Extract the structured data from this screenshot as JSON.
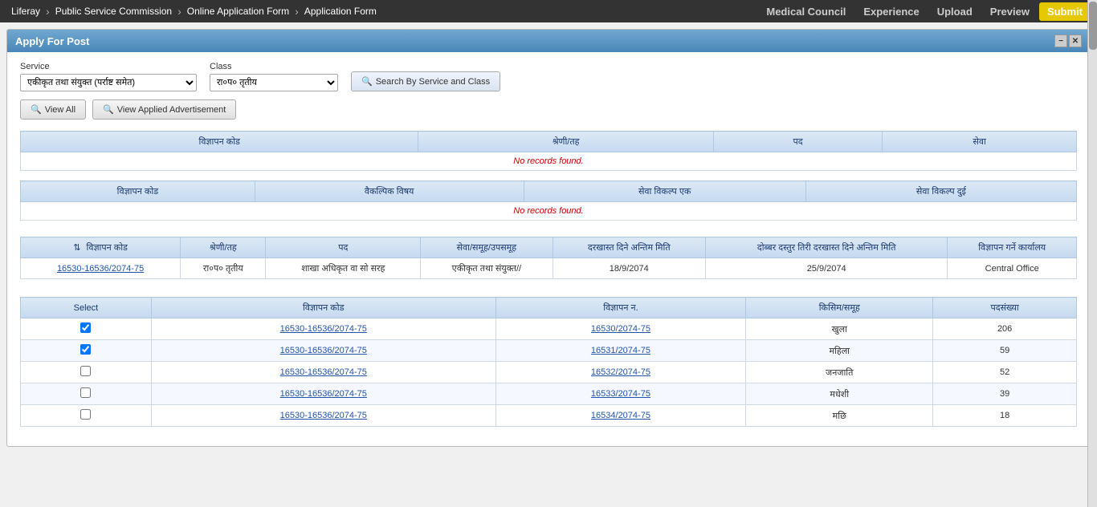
{
  "breadcrumb": {
    "items": [
      {
        "label": "Liferay",
        "active": false
      },
      {
        "label": "Public Service Commission",
        "active": false
      },
      {
        "label": "Online Application Form",
        "active": false
      },
      {
        "label": "Application Form",
        "active": false
      }
    ]
  },
  "tabs": [
    {
      "label": "Medical Council",
      "active": false
    },
    {
      "label": "Experience",
      "active": false
    },
    {
      "label": "Upload",
      "active": false
    },
    {
      "label": "Preview",
      "active": false
    },
    {
      "label": "Submit",
      "active": true
    }
  ],
  "panel": {
    "title": "Apply For Post",
    "minimize_label": "−",
    "close_label": "✕"
  },
  "form": {
    "service_label": "Service",
    "service_value": "एकीकृत तथा संयुक्त (पर्राष्ट समेत)",
    "class_label": "Class",
    "class_value": "रा०प० तृतीय",
    "search_btn_label": "Search By Service and Class",
    "view_all_label": "View All",
    "view_applied_label": "View Applied Advertisement"
  },
  "table1": {
    "headers": [
      "विज्ञापन कोड",
      "श्रेणी/तह",
      "पद",
      "सेवा"
    ],
    "no_records": "No records found."
  },
  "table2": {
    "headers": [
      "विज्ञापन कोड",
      "वैकल्पिक विषय",
      "सेवा विकल्प एक",
      "सेवा विकल्प दुई"
    ],
    "no_records": "No records found."
  },
  "table3": {
    "headers": [
      "विज्ञापन कोड",
      "श्रेणी/तह",
      "पद",
      "सेवा/समूह/उपसमूह",
      "दरखास्त दिने अन्तिम मिति",
      "दोब्बर दस्तुर तिरी दरखास्त दिने अन्तिम मिति",
      "विज्ञापन गर्ने कार्यालय"
    ],
    "rows": [
      {
        "code": "16530-16536/2074-75",
        "grade": "रा०प० तृतीय",
        "post": "शाखा अधिकृत वा सो सरह",
        "service": "एकीकृत तथा संयुक्त//",
        "deadline": "18/9/2074",
        "double_deadline": "25/9/2074",
        "office": "Central Office"
      }
    ],
    "sort_icon": "⇅"
  },
  "table4": {
    "headers": [
      "Select",
      "विज्ञापन कोड",
      "विज्ञापन न.",
      "किसिम/समूह",
      "पदसंख्या"
    ],
    "rows": [
      {
        "checked": true,
        "code": "16530-16536/2074-75",
        "adv_no": "16530/2074-75",
        "category": "खुला",
        "count": "206"
      },
      {
        "checked": true,
        "code": "16530-16536/2074-75",
        "adv_no": "16531/2074-75",
        "category": "महिला",
        "count": "59"
      },
      {
        "checked": false,
        "code": "16530-16536/2074-75",
        "adv_no": "16532/2074-75",
        "category": "जनजाति",
        "count": "52"
      },
      {
        "checked": false,
        "code": "16530-16536/2074-75",
        "adv_no": "16533/2074-75",
        "category": "मधेशी",
        "count": "39"
      },
      {
        "checked": false,
        "code": "16530-16536/2074-75",
        "adv_no": "16534/2074-75",
        "category": "मछि",
        "count": "18"
      }
    ]
  }
}
